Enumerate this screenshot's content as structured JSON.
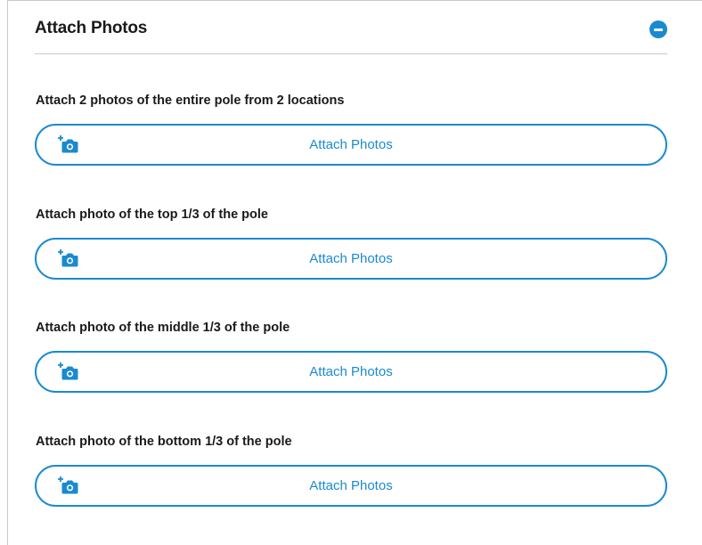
{
  "panel": {
    "title": "Attach Photos",
    "collapse_icon": "minus-circle-icon",
    "accent_color": "#1a8ad0"
  },
  "sections": [
    {
      "label": "Attach 2 photos of the entire pole from 2 locations",
      "button_label": "Attach Photos",
      "button_icon": "add-photo-icon"
    },
    {
      "label": "Attach photo of the top 1/3 of the pole",
      "button_label": "Attach Photos",
      "button_icon": "add-photo-icon"
    },
    {
      "label": "Attach photo of the middle 1/3 of the pole",
      "button_label": "Attach Photos",
      "button_icon": "add-photo-icon"
    },
    {
      "label": "Attach photo of the bottom 1/3 of the pole",
      "button_label": "Attach Photos",
      "button_icon": "add-photo-icon"
    }
  ]
}
